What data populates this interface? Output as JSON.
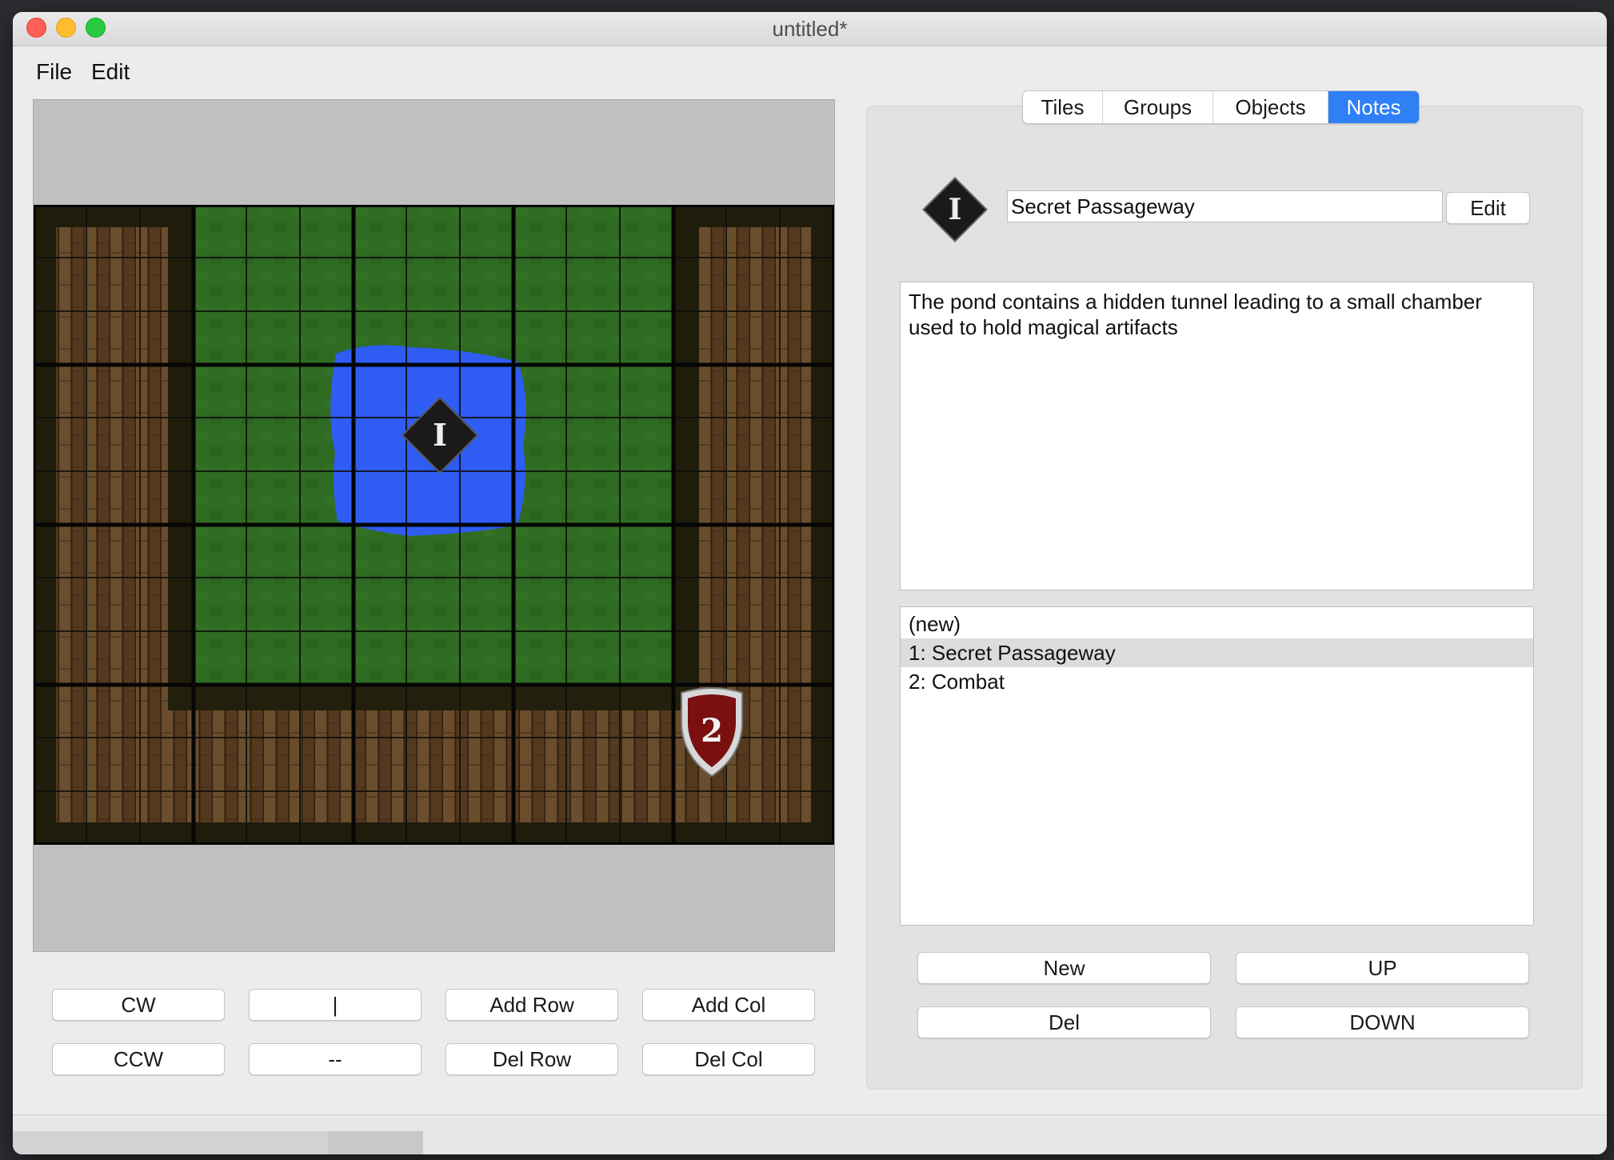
{
  "window": {
    "title": "untitled*"
  },
  "menu": {
    "items": [
      "File",
      "Edit"
    ]
  },
  "map_controls": {
    "cw": "CW",
    "pipe": "|",
    "add_row": "Add Row",
    "add_col": "Add Col",
    "ccw": "CCW",
    "dash": "--",
    "del_row": "Del Row",
    "del_col": "Del Col"
  },
  "map": {
    "markers": {
      "note_marker": "I",
      "encounter_marker": "2"
    },
    "colors": {
      "grass": "#2f6b22",
      "water": "#2f5cf2",
      "wood": "#5b4225",
      "wall": "#1f1c0c"
    }
  },
  "tabs": [
    {
      "label": "Tiles",
      "active": false
    },
    {
      "label": "Groups",
      "active": false
    },
    {
      "label": "Objects",
      "active": false
    },
    {
      "label": "Notes",
      "active": true
    }
  ],
  "note": {
    "icon_letter": "I",
    "name": "Secret Passageway",
    "edit_button": "Edit",
    "body": "The pond contains a hidden tunnel leading to a small chamber\nused to hold magical artifacts"
  },
  "notes_list": {
    "items": [
      "(new)",
      "1: Secret Passageway",
      "2: Combat"
    ],
    "selected_index": 1
  },
  "list_controls": {
    "new": "New",
    "up": "UP",
    "del": "Del",
    "down": "DOWN"
  },
  "accent_color": "#2f7ff7"
}
